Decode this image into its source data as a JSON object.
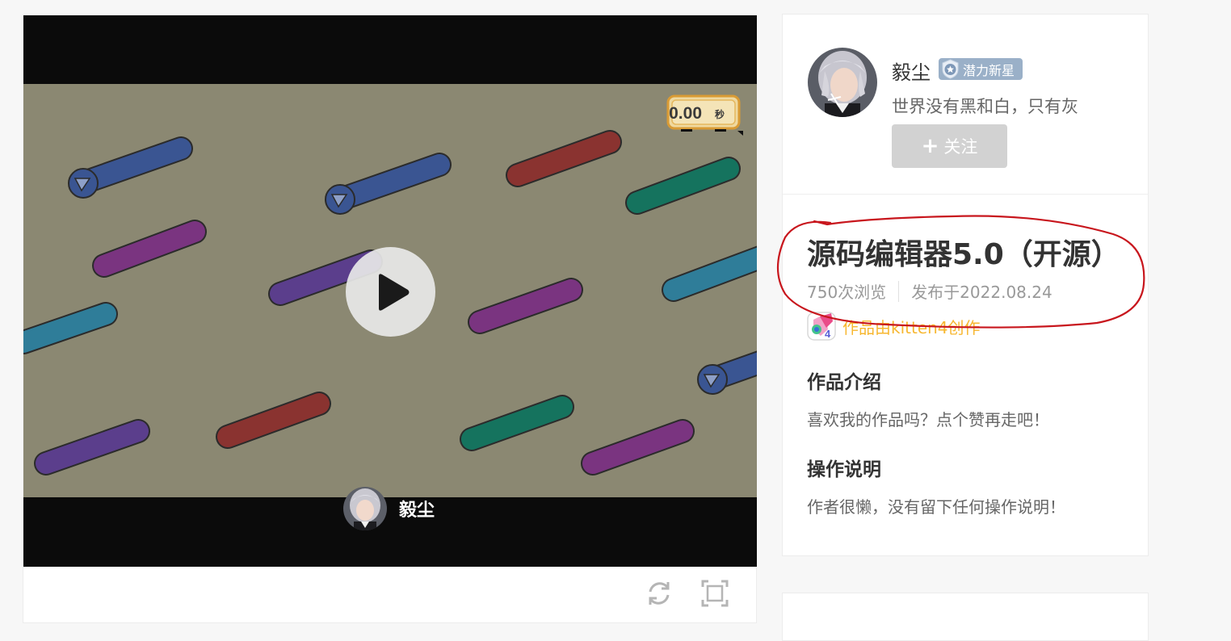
{
  "player": {
    "timer_value": "0.00",
    "timer_unit": "秒",
    "author_name": "毅尘",
    "play_icon": "play-icon",
    "refresh_icon": "refresh-icon",
    "fullscreen_icon": "fullscreen-icon",
    "colors": {
      "letterbox": "#0b0b0b",
      "stage_bg": "#8b8872",
      "blue": "#3a5592",
      "purple": "#7a3480",
      "violet": "#5b3e8c",
      "teal": "#2f7d99",
      "red": "#8a3330",
      "green": "#15735e"
    }
  },
  "author": {
    "name": "毅尘",
    "badge": "潜力新星",
    "badge_icon": "star-shield-icon",
    "signature": "世界没有黑和白，只有灰",
    "follow_label": "关注",
    "follow_icon": "plus-icon"
  },
  "work": {
    "title": "源码编辑器5.0（开源）",
    "views": "750次浏览",
    "published": "发布于2022.08.24",
    "made_with": "作品由kitten4创作",
    "made_with_icon": "kitten4-icon",
    "intro_heading": "作品介绍",
    "intro_text": "喜欢我的作品吗？点个赞再走吧！",
    "instructions_heading": "操作说明",
    "instructions_text": "作者很懒，没有留下任何操作说明！"
  },
  "colors": {
    "badge_bg": "#9ab0c8",
    "follow_bg": "#d2d2d2",
    "made_with_text": "#f7b730",
    "annotation_red": "#c8161d"
  }
}
